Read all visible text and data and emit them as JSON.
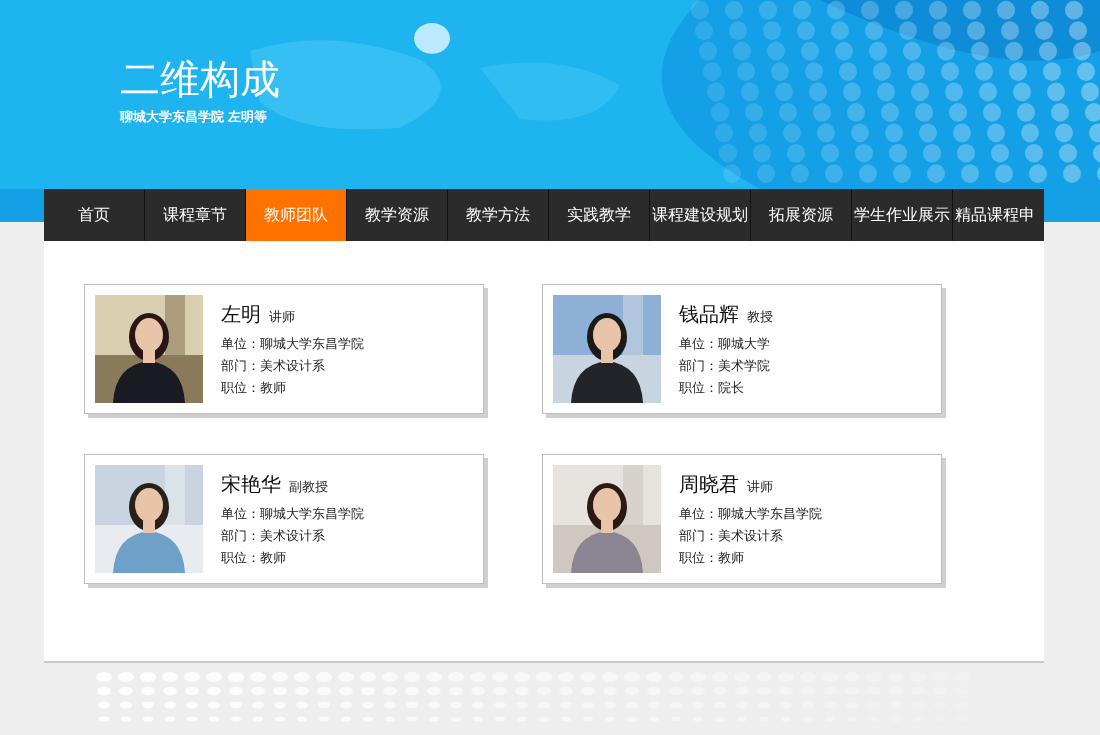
{
  "header": {
    "title": "二维构成",
    "subtitle": "聊城大学东昌学院 左明等"
  },
  "nav": [
    {
      "label": "首页",
      "selected": false
    },
    {
      "label": "课程章节",
      "selected": false
    },
    {
      "label": "教师团队",
      "selected": true
    },
    {
      "label": "教学资源",
      "selected": false
    },
    {
      "label": "教学方法",
      "selected": false
    },
    {
      "label": "实践教学",
      "selected": false
    },
    {
      "label": "课程建设规划",
      "selected": false
    },
    {
      "label": "拓展资源",
      "selected": false
    },
    {
      "label": "学生作业展示",
      "selected": false
    },
    {
      "label": "精品课程申",
      "selected": false
    }
  ],
  "teachers": [
    {
      "name": "左明",
      "title": "讲师",
      "photo": {
        "kind": "picture"
      },
      "details": [
        "单位：聊城大学东昌学院",
        "部门：美术设计系",
        "职位：教师"
      ]
    },
    {
      "name": "钱品辉",
      "title": "教授",
      "photo": {
        "kind": "picture"
      },
      "details": [
        "单位：聊城大学",
        "部门：美术学院",
        "职位：院长"
      ]
    },
    {
      "name": "宋艳华",
      "title": "副教授",
      "photo": {
        "kind": "picture"
      },
      "details": [
        "单位：聊城大学东昌学院",
        "部门：美术设计系",
        "职位：教师"
      ]
    },
    {
      "name": "周晓君",
      "title": "讲师",
      "photo": {
        "kind": "picture"
      },
      "details": [
        "单位：聊城大学东昌学院",
        "部门：美术设计系",
        "职位：教师"
      ]
    }
  ]
}
